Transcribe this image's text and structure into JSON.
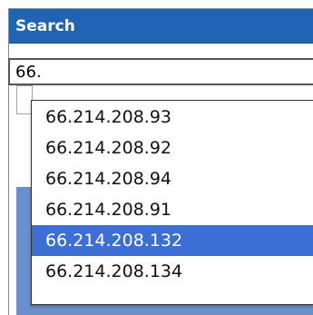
{
  "panel": {
    "title": "Search"
  },
  "search": {
    "value": "66."
  },
  "suggestions": [
    {
      "label": "66.214.208.93",
      "selected": false
    },
    {
      "label": "66.214.208.92",
      "selected": false
    },
    {
      "label": "66.214.208.94",
      "selected": false
    },
    {
      "label": "66.214.208.91",
      "selected": false
    },
    {
      "label": "66.214.208.132",
      "selected": true
    },
    {
      "label": "66.214.208.134",
      "selected": false
    }
  ],
  "colors": {
    "header": "#1f64b3",
    "selected": "#3d6fd2",
    "under_panel": "#6a8fcb"
  }
}
